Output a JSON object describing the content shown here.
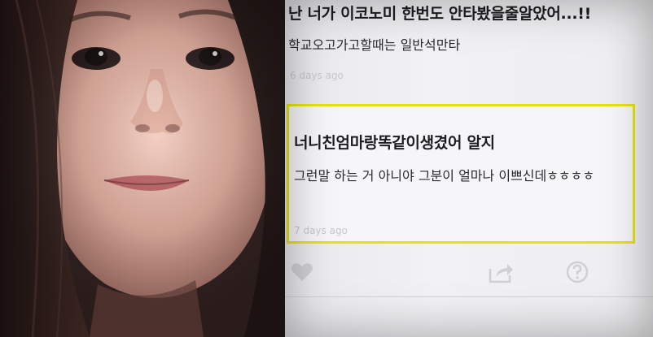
{
  "post": {
    "title": "난 너가 이코노미 한번도 안타봤을줄알았어...!!",
    "body": "학교오고가고할때는 일반석만타",
    "time": "6 days ago"
  },
  "highlighted_comment": {
    "title": "너니친엄마랑똑같이생겼어 알지",
    "body": "그런말 하는 거 아니야 그분이 얼마나 이쁘신데ㅎㅎㅎㅎ",
    "time": "7 days ago",
    "highlight_color": "#e6e01a"
  },
  "actions": {
    "like_icon": "heart-icon",
    "share_icon": "share-icon",
    "help_icon": "question-icon"
  },
  "colors": {
    "app_background": "#eeeef0",
    "text": "#1d1d1f",
    "timestamp": "#c8c8cc",
    "icon": "#cfcfd4"
  }
}
